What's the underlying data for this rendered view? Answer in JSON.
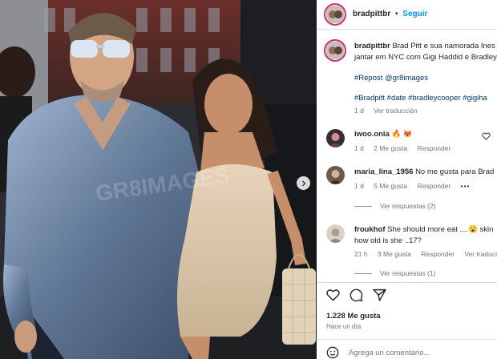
{
  "post": {
    "username": "bradpittbr",
    "separator": "•",
    "follow_label": "Seguir"
  },
  "caption": {
    "username": "bradpittbr",
    "text_line1": "Brad Pitt e sua namorada Ines",
    "text_line2": "jantar em NYC com Gigi Haddid e Bradley",
    "repost": "#Repost @gr8images",
    "hashtags": "#Bradpitt #date #bradleycooper #gigiha",
    "time": "1 d",
    "translate": "Ver traducción"
  },
  "comments": [
    {
      "username": "iwoo.onia",
      "text": "🔥 😻",
      "time": "1 d",
      "likes": "2 Me gusta",
      "reply": "Responder"
    },
    {
      "username": "maria_lina_1956",
      "text": "No me gusta para Brad",
      "time": "1 d",
      "likes": "5 Me gusta",
      "reply": "Responder",
      "more": "•••",
      "view_replies": "Ver respuestas (2)"
    },
    {
      "username": "froukhof",
      "text_line1": "She should more eat ....😮 skin",
      "text_line2": "how old is she ..17?",
      "time": "21 h",
      "likes": "3 Me gusta",
      "reply": "Responder",
      "translate": "Ver traducción",
      "view_replies": "Ver respuestas (1)"
    }
  ],
  "footer": {
    "likes": "1.228 Me gusta",
    "posted": "Hace un día",
    "add_comment_placeholder": "Agrega un comentario..."
  },
  "icons": {
    "like": "heart-icon",
    "comment": "comment-icon",
    "share": "paper-plane-icon",
    "emoji": "smiley-icon",
    "next": "chevron-right-icon"
  },
  "colors": {
    "link_blue": "#0095f6",
    "hashtag": "#00376b",
    "story_ring": "#d62976"
  }
}
